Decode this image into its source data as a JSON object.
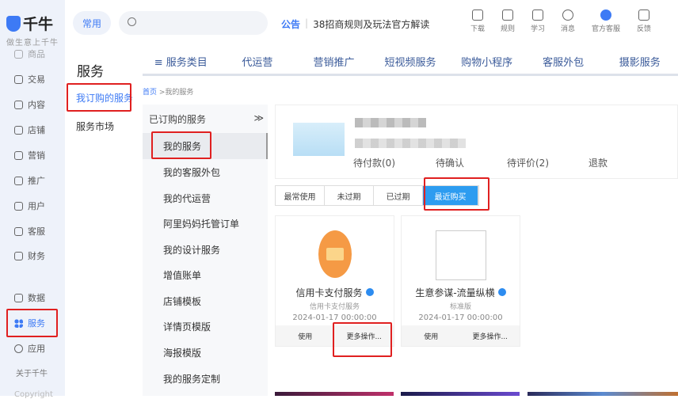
{
  "app": {
    "logo": "千牛",
    "slogan": "做生意上千牛"
  },
  "sidebar": {
    "items": [
      {
        "label": "商品"
      },
      {
        "label": "交易"
      },
      {
        "label": "内容"
      },
      {
        "label": "店铺"
      },
      {
        "label": "营销"
      },
      {
        "label": "推广"
      },
      {
        "label": "用户"
      },
      {
        "label": "客服"
      },
      {
        "label": "财务"
      },
      {
        "label": "数据"
      },
      {
        "label": "服务"
      },
      {
        "label": "应用"
      }
    ],
    "about": "关于千牛",
    "copyright": "Copyright"
  },
  "header": {
    "frequent": "常用",
    "search_placeholder": "",
    "notice_label": "公告",
    "notice_text": "38招商规则及玩法官方解读",
    "tools": [
      {
        "label": "下载",
        "icon": "download-icon"
      },
      {
        "label": "规则",
        "icon": "rules-icon"
      },
      {
        "label": "学习",
        "icon": "learn-icon"
      },
      {
        "label": "消息",
        "icon": "message-icon"
      },
      {
        "label": "官方客服",
        "icon": "customer-service-icon"
      },
      {
        "label": "反馈",
        "icon": "feedback-icon"
      }
    ]
  },
  "service_nav": {
    "title": "服务",
    "items": [
      {
        "label": "我订购的服务"
      },
      {
        "label": "服务市场"
      }
    ]
  },
  "tabs": [
    {
      "label": "≡ 服务类目"
    },
    {
      "label": "代运营"
    },
    {
      "label": "营销推广"
    },
    {
      "label": "短视频服务"
    },
    {
      "label": "购物小程序"
    },
    {
      "label": "客服外包"
    },
    {
      "label": "摄影服务"
    }
  ],
  "breadcrumb": {
    "home": "首页",
    "current": ">我的服务"
  },
  "menu": {
    "header": "已订购的服务",
    "collapse": "≫",
    "items": [
      {
        "label": "我的服务"
      },
      {
        "label": "我的客服外包"
      },
      {
        "label": "我的代运营"
      },
      {
        "label": "阿里妈妈托管订单"
      },
      {
        "label": "我的设计服务"
      },
      {
        "label": "增值账单"
      },
      {
        "label": "店铺模板"
      },
      {
        "label": "详情页模版"
      },
      {
        "label": "海报模版"
      },
      {
        "label": "我的服务定制"
      }
    ]
  },
  "summary": {
    "stats": [
      {
        "label": "待付款(0)"
      },
      {
        "label": "待确认"
      },
      {
        "label": "待评价(2)"
      },
      {
        "label": "退款"
      }
    ]
  },
  "filters": [
    {
      "label": "最常使用"
    },
    {
      "label": "未过期"
    },
    {
      "label": "已过期"
    },
    {
      "label": "最近购买",
      "active": true
    }
  ],
  "cards": [
    {
      "name": "信用卡支付服务",
      "sub": "信用卡支付服务",
      "date": "2024-01-17 00:00:00",
      "use": "使用",
      "more": "更多操作..."
    },
    {
      "name": "生意参谋-流量纵横",
      "sub": "标准版",
      "date": "2024-01-17 00:00:00",
      "use": "使用",
      "more": "更多操作..."
    }
  ],
  "colors": {
    "accent": "#3d7af5",
    "highlight": "#e02020",
    "active_filter": "#2d9cf0",
    "card_icon": "#f59a45"
  }
}
